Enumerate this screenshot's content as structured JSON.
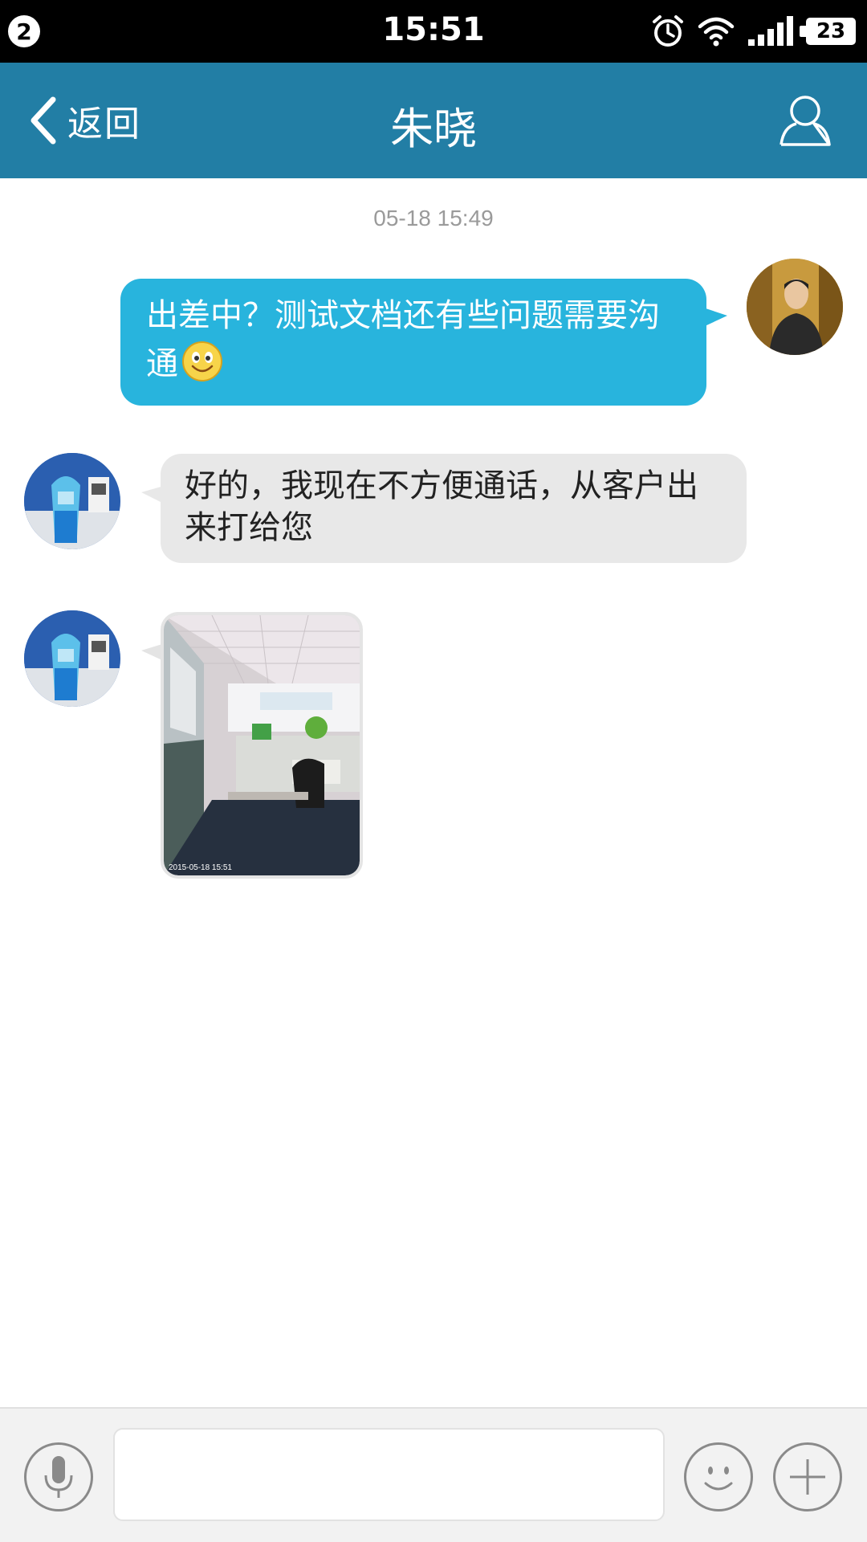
{
  "status_bar": {
    "notification_count": "2",
    "time": "15:51",
    "battery_level": "23",
    "icons": [
      "alarm-icon",
      "wifi-icon",
      "signal-icon",
      "battery-icon"
    ]
  },
  "header": {
    "back_label": "返回",
    "title": "朱晓",
    "contact_icon": "person-outline-icon",
    "background_color": "#227ea5"
  },
  "chat": {
    "timestamp": "05-18 15:49",
    "messages": [
      {
        "direction": "outgoing",
        "type": "text",
        "text": "出差中？测试文档还有些问题需要沟通",
        "emoji": "smiley-emoji",
        "bubble_color": "#28b4dd"
      },
      {
        "direction": "incoming",
        "type": "text",
        "text": "好的，我现在不方便通话，从客户出来打给您",
        "bubble_color": "#e8e8e8"
      },
      {
        "direction": "incoming",
        "type": "image",
        "photo_stamp": "2015-05-18 15:51",
        "image_desc": "office-photo"
      }
    ]
  },
  "input_bar": {
    "input_value": "",
    "voice_icon": "microphone-icon",
    "emoji_icon": "smiley-icon",
    "plus_icon": "plus-icon"
  }
}
